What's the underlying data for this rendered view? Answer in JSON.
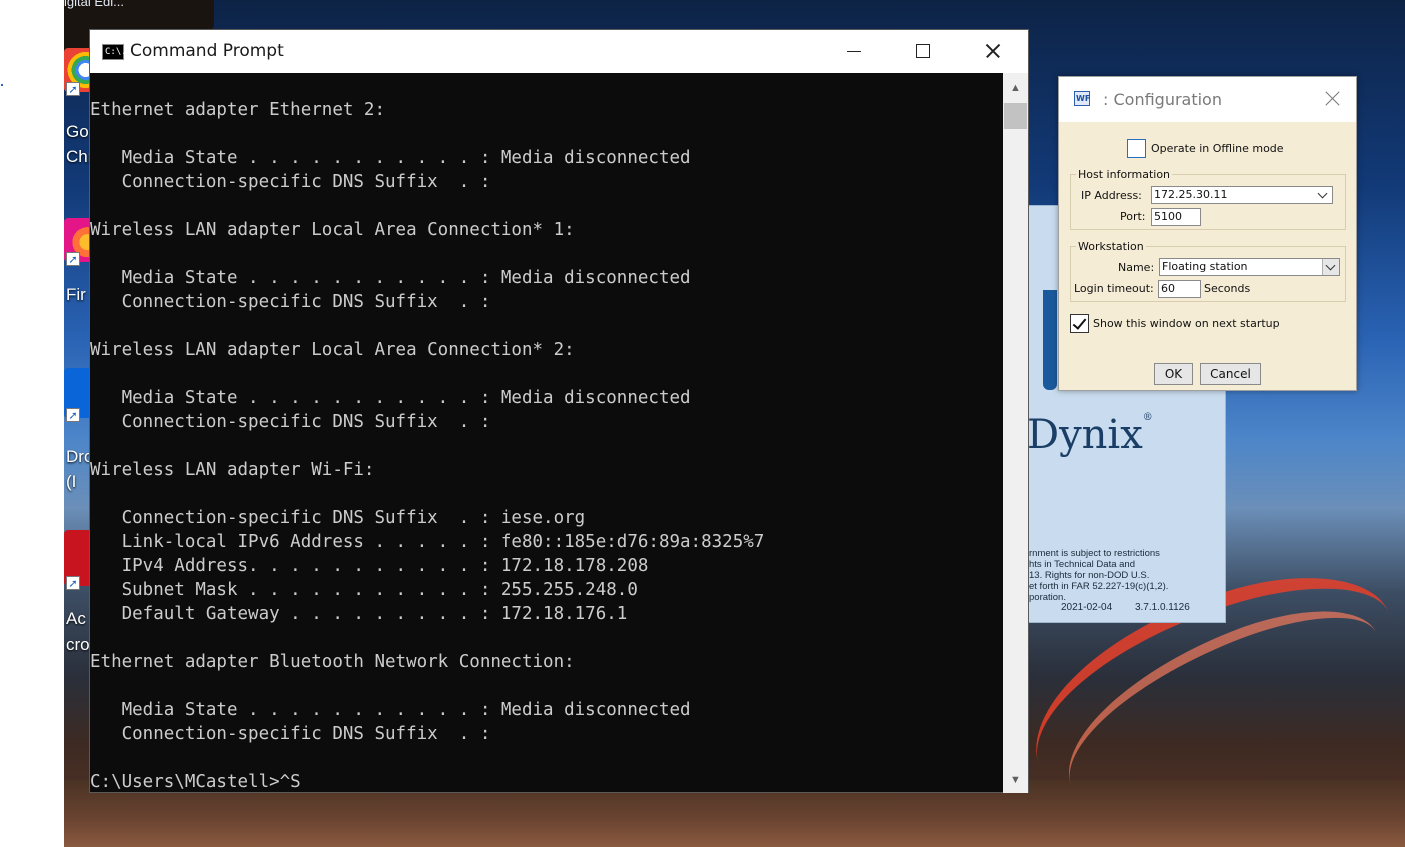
{
  "desktop": {
    "top_label": "igital Edi...",
    "icon_labels": [
      "Go",
      "Chr",
      "Fir",
      "Dro",
      "(I",
      "Ac",
      "cro"
    ]
  },
  "splash": {
    "brand": "Dynix",
    "registered_mark": "®",
    "legal_lines": [
      "rnment is subject to restrictions",
      "hts in Technical Data and",
      "13. Rights for non-DOD U.S.",
      "et forth in FAR 52.227-19(c)(1,2).",
      "poration."
    ],
    "date": "2021-02-04",
    "version": "3.7.1.0.1126"
  },
  "cmd": {
    "icon_text": "C:\\.",
    "title": "Command Prompt",
    "lines": [
      "Ethernet adapter Ethernet 2:",
      "",
      "   Media State . . . . . . . . . . . : Media disconnected",
      "   Connection-specific DNS Suffix  . :",
      "",
      "Wireless LAN adapter Local Area Connection* 1:",
      "",
      "   Media State . . . . . . . . . . . : Media disconnected",
      "   Connection-specific DNS Suffix  . :",
      "",
      "Wireless LAN adapter Local Area Connection* 2:",
      "",
      "   Media State . . . . . . . . . . . : Media disconnected",
      "   Connection-specific DNS Suffix  . :",
      "",
      "Wireless LAN adapter Wi-Fi:",
      "",
      "   Connection-specific DNS Suffix  . : iese.org",
      "   Link-local IPv6 Address . . . . . : fe80::185e:d76:89a:8325%7",
      "   IPv4 Address. . . . . . . . . . . : 172.18.178.208",
      "   Subnet Mask . . . . . . . . . . . : 255.255.248.0",
      "   Default Gateway . . . . . . . . . : 172.18.176.1",
      "",
      "Ethernet adapter Bluetooth Network Connection:",
      "",
      "   Media State . . . . . . . . . . . : Media disconnected",
      "   Connection-specific DNS Suffix  . :",
      "",
      "C:\\Users\\MCastell>^S"
    ]
  },
  "config": {
    "icon_text": "WF",
    "title": ": Configuration",
    "offline_label": "Operate in Offline mode",
    "offline_checked": false,
    "host_group": "Host information",
    "ip_label": "IP Address:",
    "ip_value": "172.25.30.11",
    "port_label": "Port:",
    "port_value": "5100",
    "ws_group": "Workstation",
    "name_label": "Name:",
    "name_value": "Floating station",
    "timeout_label": "Login timeout:",
    "timeout_value": "60",
    "timeout_unit": "Seconds",
    "startup_label": "Show this window on next startup",
    "startup_checked": true,
    "ok_label": "OK",
    "cancel_label": "Cancel"
  }
}
